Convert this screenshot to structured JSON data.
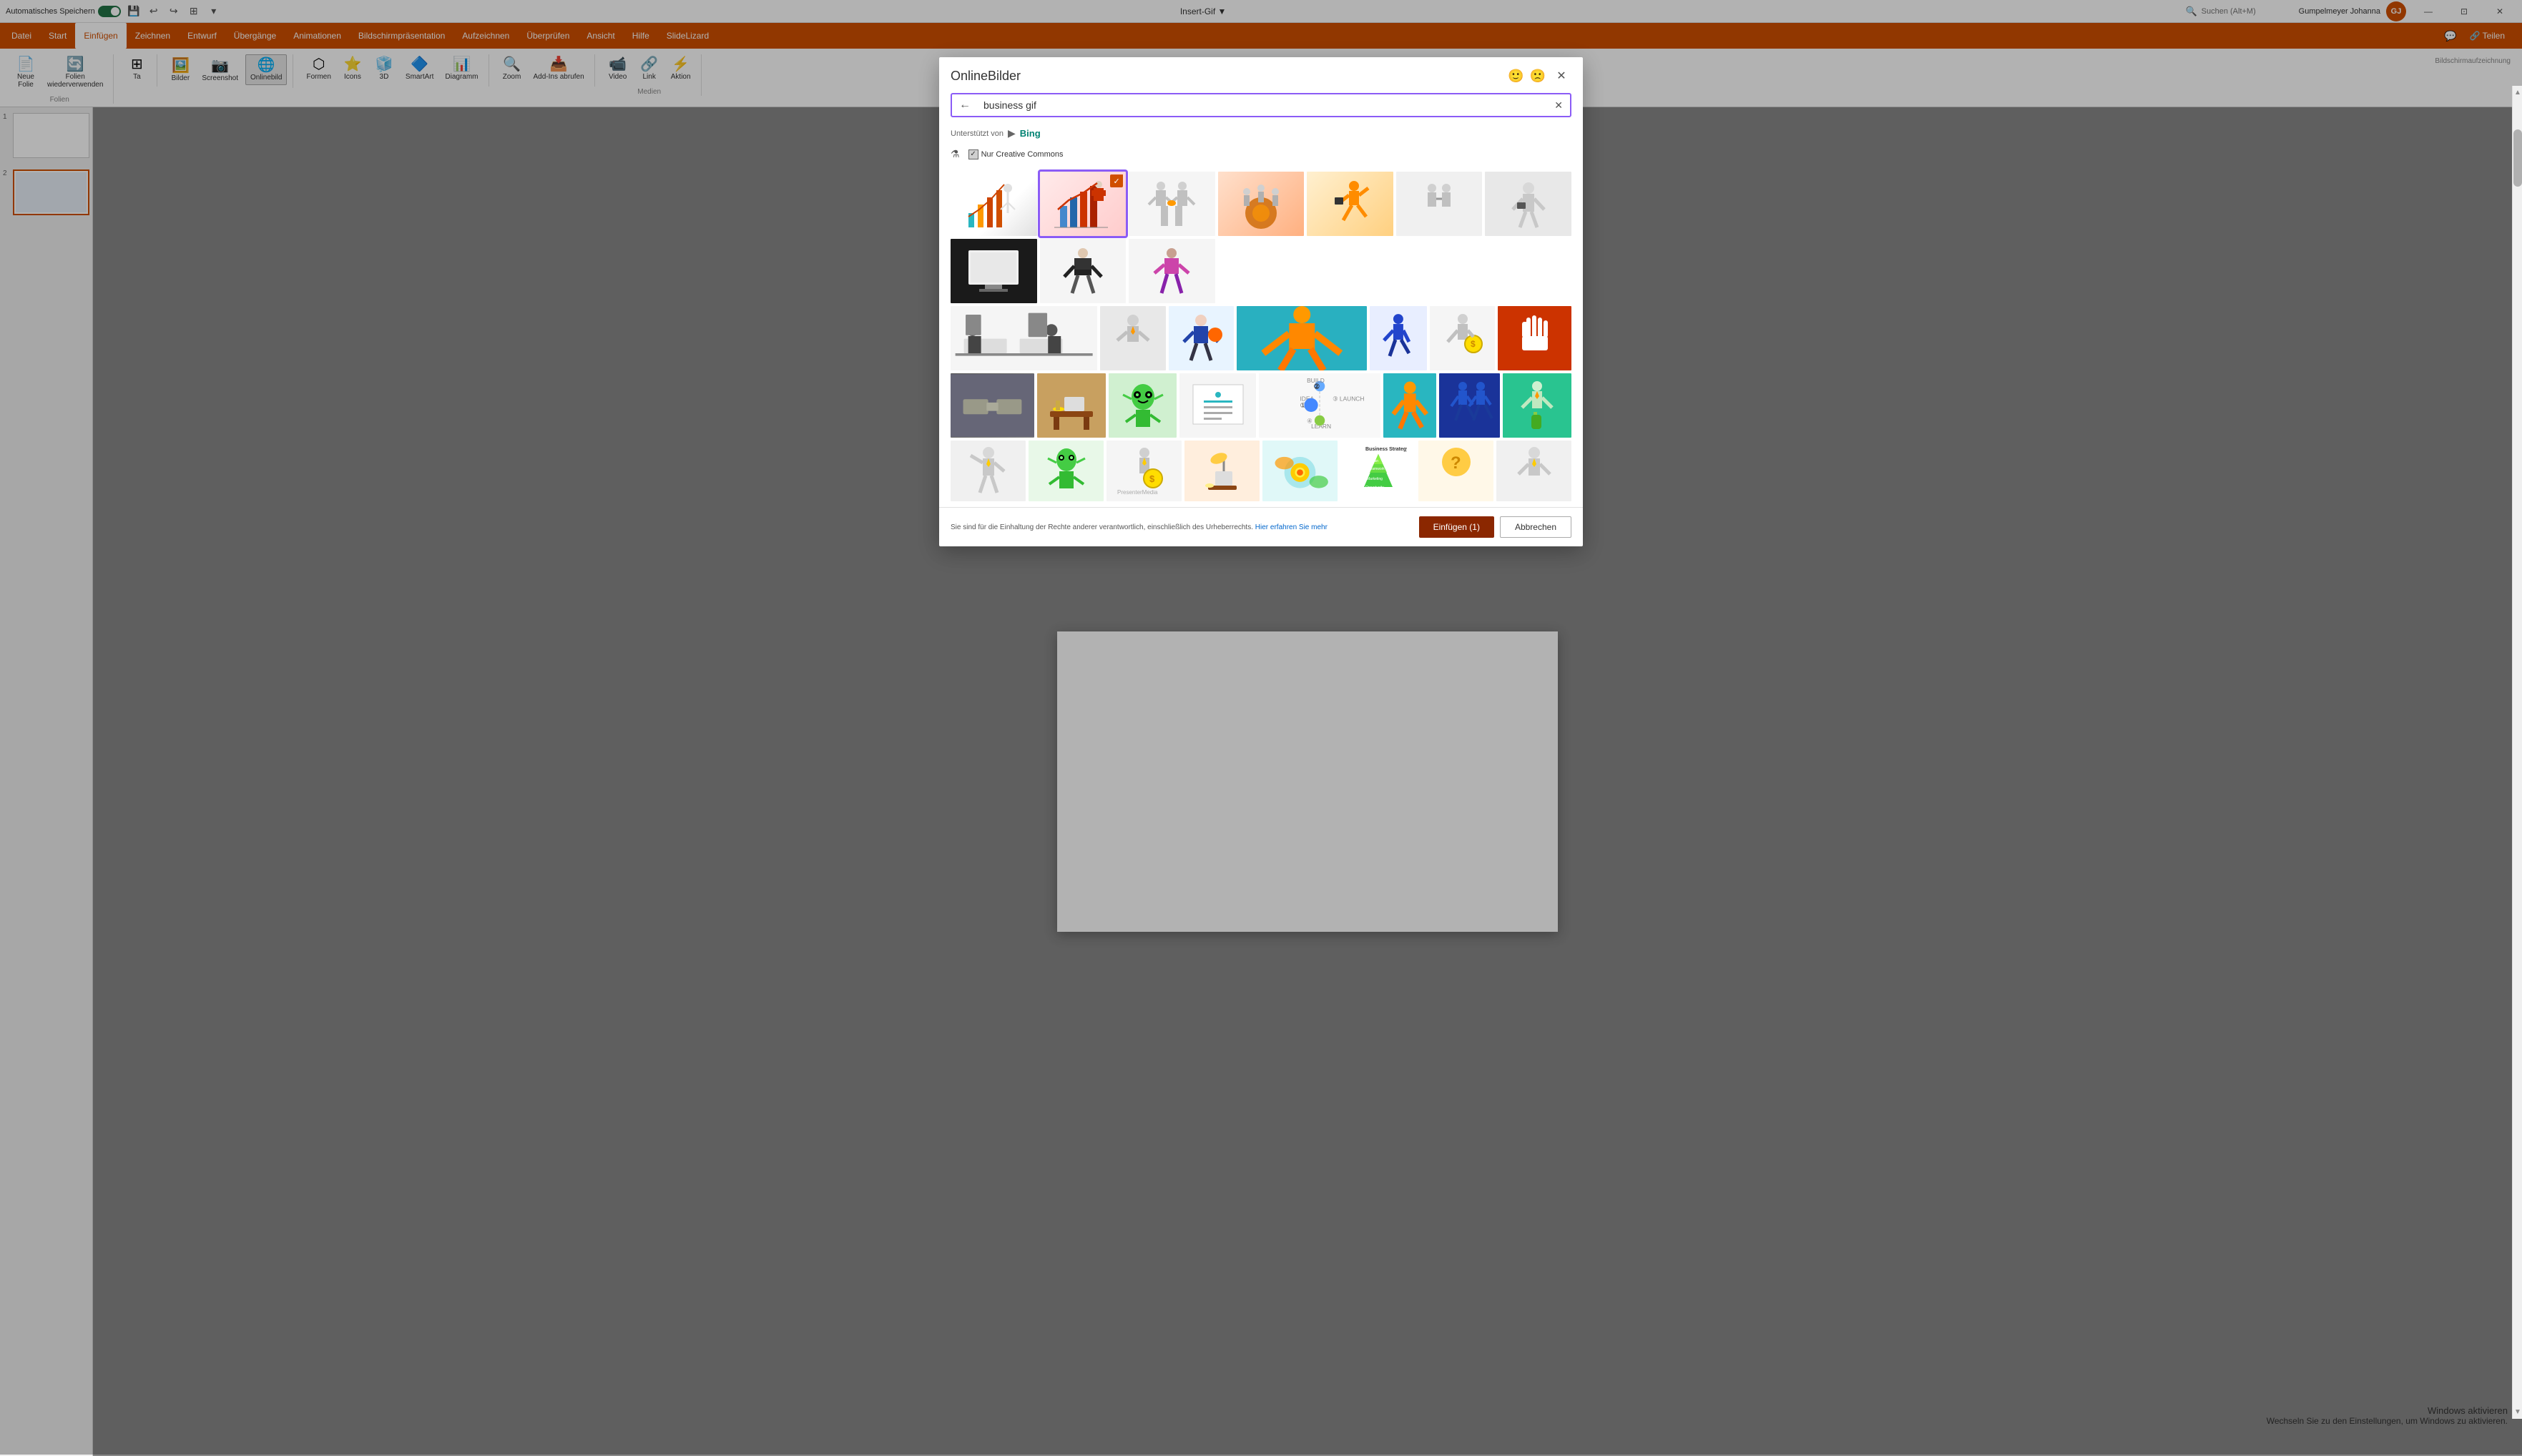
{
  "titleBar": {
    "autosave": "Automatisches Speichern",
    "title": "Insert-Gif ▼",
    "searchPlaceholder": "Suchen (Alt+M)",
    "user": "Gumpelmeyer Johanna",
    "initials": "GJ"
  },
  "menuBar": {
    "items": [
      "Datei",
      "Start",
      "Einfügen",
      "Zeichnen",
      "Entwurf",
      "Übergänge",
      "Animationen",
      "Bildschirmpräsentation",
      "Aufzeichnen",
      "Überprüfen",
      "Ansicht",
      "Hilfe",
      "SlideLizard"
    ],
    "activeIndex": 2
  },
  "ribbon": {
    "shareLabel": "Teilen",
    "groups": [
      {
        "name": "Folien",
        "items": [
          "Neue Folie",
          "Folien wiederverwenden"
        ]
      },
      {
        "name": "Ta",
        "items": [
          "Ta"
        ]
      }
    ]
  },
  "dialog": {
    "title": "OnlineBilder",
    "searchValue": "business gif",
    "searchPlaceholder": "business gif",
    "poweredBy": "Unterstützt von",
    "bingLabel": "Bing",
    "filterLabel": "Nur Creative Commons",
    "footerNotice": "Sie sind für die Einhaltung der Rechte anderer verantwortlich, einschließlich des Urheberrechts.",
    "footerLink": "Hier erfahren Sie mehr",
    "insertBtn": "Einfügen (1)",
    "cancelBtn": "Abbrechen",
    "images": [
      {
        "id": 1,
        "bg": "#f5f5f5",
        "emoji": "📊",
        "selected": false
      },
      {
        "id": 2,
        "bg": "#ffeaea",
        "emoji": "📈",
        "selected": true
      },
      {
        "id": 3,
        "bg": "#f0f0f0",
        "emoji": "🤝",
        "selected": false
      },
      {
        "id": 4,
        "bg": "#ffcc99",
        "emoji": "⚙️",
        "selected": false
      },
      {
        "id": 5,
        "bg": "#fff0d0",
        "emoji": "🏃",
        "selected": false
      },
      {
        "id": 6,
        "bg": "#f0f0f0",
        "emoji": "🤝",
        "selected": false
      },
      {
        "id": 7,
        "bg": "#e8e8e8",
        "emoji": "🧍",
        "selected": false
      },
      {
        "id": 8,
        "bg": "#1a1a1a",
        "emoji": "🖥️",
        "selected": false
      },
      {
        "id": 9,
        "bg": "#f5f5f5",
        "emoji": "👔",
        "selected": false
      },
      {
        "id": 10,
        "bg": "#f0e0f0",
        "emoji": "👩",
        "selected": false
      },
      {
        "id": 11,
        "bg": "#f0f0f0",
        "emoji": "🖥️",
        "selected": false
      },
      {
        "id": 12,
        "bg": "#e8f0f8",
        "emoji": "🤔",
        "selected": false
      },
      {
        "id": 13,
        "bg": "#29c0d0",
        "emoji": "🕺",
        "selected": false
      },
      {
        "id": 14,
        "bg": "#ff6600",
        "emoji": "🙋",
        "selected": false
      },
      {
        "id": 15,
        "bg": "#f5f5f5",
        "emoji": "💰",
        "selected": false
      },
      {
        "id": 16,
        "bg": "#cc4400",
        "emoji": "✋",
        "selected": false
      },
      {
        "id": 17,
        "bg": "#f5f5f5",
        "emoji": "🤝",
        "selected": false
      },
      {
        "id": 18,
        "bg": "#c8a060",
        "emoji": "💼",
        "selected": false
      },
      {
        "id": 19,
        "bg": "#44cc44",
        "emoji": "👾",
        "selected": false
      },
      {
        "id": 20,
        "bg": "#f5f5f5",
        "emoji": "📋",
        "selected": false
      },
      {
        "id": 21,
        "bg": "#29b6c0",
        "emoji": "🕺",
        "selected": false
      },
      {
        "id": 22,
        "bg": "#2244aa",
        "emoji": "🚶",
        "selected": false
      },
      {
        "id": 23,
        "bg": "#29c490",
        "emoji": "🍾",
        "selected": false
      },
      {
        "id": 24,
        "bg": "#f5f5f5",
        "emoji": "🙋",
        "selected": false
      },
      {
        "id": 25,
        "bg": "#44cc44",
        "emoji": "👾",
        "selected": false
      },
      {
        "id": 26,
        "bg": "#f5f5f5",
        "emoji": "💰",
        "selected": false
      },
      {
        "id": 27,
        "bg": "#ffeecc",
        "emoji": "💼",
        "selected": false
      },
      {
        "id": 28,
        "bg": "#29c0d0",
        "emoji": "💡",
        "selected": false
      },
      {
        "id": 29,
        "bg": "#8fcc44",
        "emoji": "📊",
        "selected": false
      },
      {
        "id": 30,
        "bg": "#f5f5f5",
        "emoji": "❓",
        "selected": false
      },
      {
        "id": 31,
        "bg": "#f5f5f5",
        "emoji": "🧍",
        "selected": false
      }
    ]
  },
  "slides": [
    {
      "number": "1"
    },
    {
      "number": "2"
    }
  ],
  "activateWindows": {
    "title": "Windows aktivieren",
    "subtitle": "Wechseln Sie zu den Einstellungen, um Windows zu aktivieren."
  }
}
